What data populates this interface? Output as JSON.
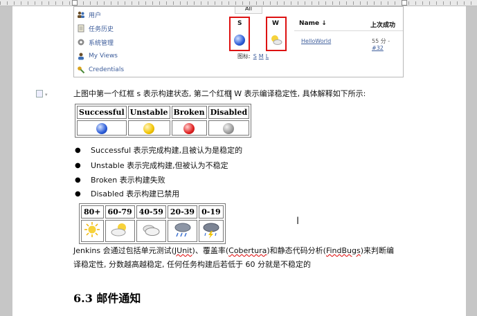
{
  "jenkins": {
    "sidebar": [
      {
        "label": "用户",
        "icon": "people-icon"
      },
      {
        "label": "任务历史",
        "icon": "notepad-icon"
      },
      {
        "label": "系统管理",
        "icon": "gear-icon"
      },
      {
        "label": "My Views",
        "icon": "user-icon"
      },
      {
        "label": "Credentials",
        "icon": "key-icon"
      }
    ],
    "tab_all": "All",
    "col_s": "S",
    "col_w": "W",
    "col_name": "Name ↓",
    "col_last_success": "上次成功",
    "job_name": "HelloWorld",
    "last_success_text": "55 分 -",
    "last_success_link": "#32",
    "legend_label": "图标:",
    "legend_sizes": [
      "S",
      "M",
      "L"
    ]
  },
  "intro_text": "上图中第一个红框 s 表示构建状态, 第二个红框 W 表示编译稳定性, 具体解释如下所示:",
  "status_table": {
    "headers": [
      "Successful",
      "Unstable",
      "Broken",
      "Disabled"
    ],
    "colors": [
      "#2a5bd8",
      "#f2c400",
      "#e02020",
      "#9a9a9a"
    ]
  },
  "bullets": [
    {
      "term": "Successful",
      "text": " 表示完成构建,且被认为是稳定的"
    },
    {
      "term": "Unstable",
      "text": " 表示完成构建,但被认为不稳定"
    },
    {
      "term": "Broken",
      "text": " 表示构建失败"
    },
    {
      "term": "Disabled",
      "text": " 表示构建已禁用"
    }
  ],
  "weather_table": {
    "headers": [
      "80+",
      "60-79",
      "40-59",
      "20-39",
      "0-19"
    ],
    "icons": [
      "sunny-icon",
      "partly-cloudy-icon",
      "cloudy-icon",
      "rain-icon",
      "thunderstorm-icon"
    ]
  },
  "summary": {
    "p1": "Jenkins 会通过包括单元测试(",
    "junit": "JUnit",
    "p2": ")、覆盖率(",
    "cobertura": "Cobertura",
    "p3": ")和静态代码分析(",
    "findbugs": "FindBugs",
    "p4": ")来判断编",
    "line2": "译稳定性, 分数越高越稳定, 任何任务构建后若低于 60 分就是不稳定的"
  },
  "heading": "6.3 邮件通知"
}
